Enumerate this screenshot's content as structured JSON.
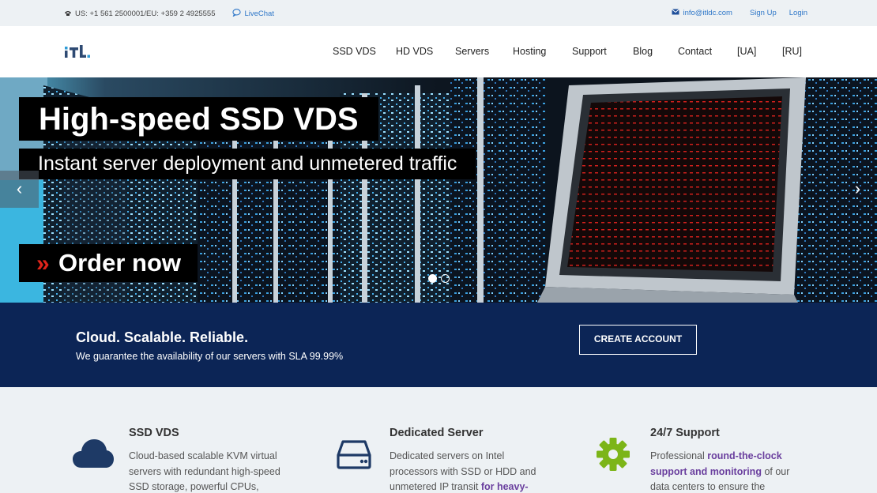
{
  "topbar": {
    "phones": "US: +1 561 2500001/EU: +359 2 4925555",
    "livechat": "LiveChat",
    "email": "info@itldc.com",
    "signup": "Sign Up",
    "login": "Login"
  },
  "nav": [
    "SSD VDS",
    "HD VDS",
    "Servers",
    "Hosting",
    "Support",
    "Blog",
    "Contact",
    "[UA]",
    "[RU]"
  ],
  "hero": {
    "title": "High-speed SSD VDS",
    "subtitle": "Instant server deployment and unmetered traffic",
    "order": "Order now",
    "chevrons": "»",
    "prev": "‹",
    "next": "›",
    "slide_count": 2,
    "active_slide": 1
  },
  "banner": {
    "title": "Cloud. Scalable. Reliable.",
    "text": "We guarantee the availability of our servers with SLA 99.99%",
    "button": "CREATE ACCOUNT"
  },
  "features": [
    {
      "icon": "cloud-icon",
      "title": "SSD VDS",
      "lines": [
        "Cloud-based scalable KVM virtual",
        "servers with redundant high-speed",
        "SSD storage, powerful CPUs,"
      ]
    },
    {
      "icon": "hard-drive-icon",
      "title": "Dedicated Server",
      "line1": "Dedicated servers on Intel",
      "line2": "processors with SSD or HDD and",
      "line3_text": "unmetered IP transit ",
      "line3_bold": "for heavy-"
    },
    {
      "icon": "gear-icon",
      "title": "24/7 Support",
      "line1_text": "Professional ",
      "line1_bold": "round-the-clock",
      "line2_bold": "support and monitoring",
      "line2_text": " of our",
      "line3": "data centers to ensure the"
    }
  ],
  "colors": {
    "link": "#2f77c8",
    "banner_bg": "#0c2556",
    "accent_red": "#e0241b",
    "icon_navy": "#1e3a66",
    "icon_green": "#7cb518",
    "highlight_purple": "#6a3f9e"
  }
}
